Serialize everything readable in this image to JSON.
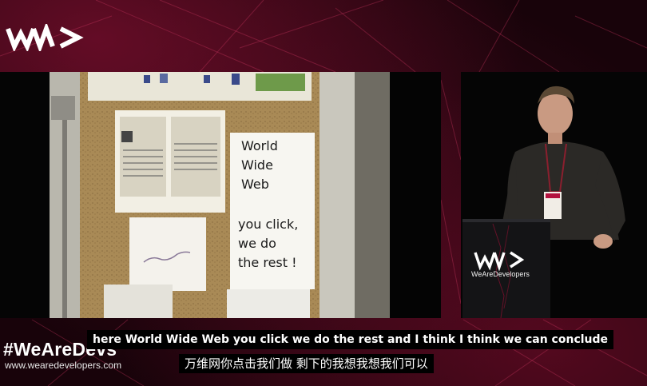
{
  "brand": {
    "logo_icon": "wearedevelopers-logo-icon",
    "hashtag": "#WeAreDevs",
    "website": "www.wearedevelopers.com",
    "podium_name": "WeAreDevelopers",
    "accent_color": "#b3123f"
  },
  "slide": {
    "poster_lines": [
      "World",
      "Wide",
      "Web",
      "you click,",
      "we do",
      "the rest !"
    ]
  },
  "subtitles": {
    "english": "here World Wide Web you click we do the rest and I think I think we can conclude",
    "chinese": "万维网你点击我们做 剩下的我想我想我们可以"
  }
}
